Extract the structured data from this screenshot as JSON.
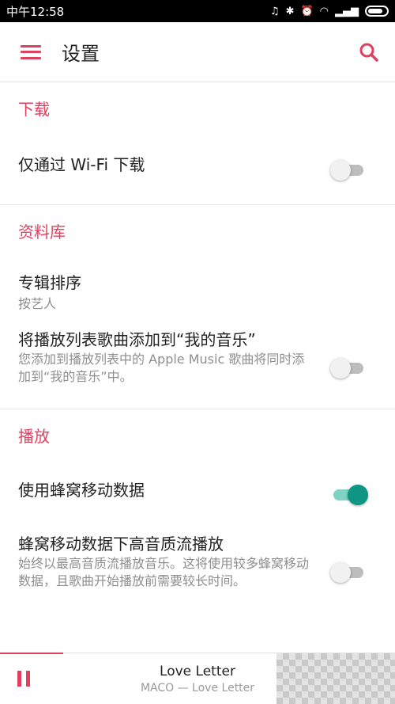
{
  "status_bar": {
    "carrier_time": "中午12:58"
  },
  "header": {
    "title": "设置"
  },
  "sections": {
    "download": {
      "title": "下载",
      "wifi_only": {
        "label": "仅通过 Wi-Fi 下载",
        "enabled": false
      }
    },
    "library": {
      "title": "资料库",
      "album_sort": {
        "label": "专辑排序",
        "value": "按艺人"
      },
      "add_to_my_music": {
        "label": "将播放列表歌曲添加到“我的音乐”",
        "description": "您添加到播放列表中的 Apple Music 歌曲将同时添加到“我的音乐”中。",
        "enabled": false
      }
    },
    "playback": {
      "title": "播放",
      "cellular_data": {
        "label": "使用蜂窝移动数据",
        "enabled": true
      },
      "hq_streaming": {
        "label": "蜂窝移动数据下高音质流播放",
        "description": "始终以最高音质流播放音乐。这将使用较多蜂窝移动数据，且歌曲开始播放前需要较长时间。",
        "enabled": false
      }
    }
  },
  "now_playing": {
    "title": "Love Letter",
    "subtitle": "MACO — Love Letter",
    "progress": 0.16
  },
  "colors": {
    "accent": "#e0405f",
    "toggle_on": "#0f9682"
  }
}
